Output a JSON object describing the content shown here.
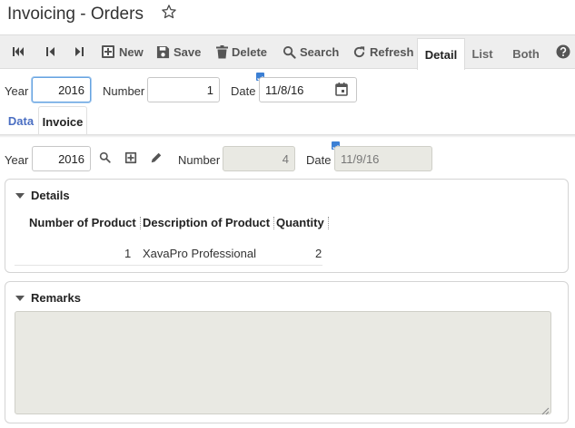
{
  "app": {
    "title": "Invoicing - Orders"
  },
  "toolbar": {
    "first_label": "",
    "prev_label": "",
    "next_label": "",
    "new_label": "New",
    "save_label": "Save",
    "delete_label": "Delete",
    "search_label": "Search",
    "refresh_label": "Refresh",
    "views": [
      {
        "label": "Detail",
        "active": true
      },
      {
        "label": "List",
        "active": false
      },
      {
        "label": "Both",
        "active": false
      }
    ]
  },
  "order": {
    "year_label": "Year",
    "year_value": "2016",
    "number_label": "Number",
    "number_value": "1",
    "date_label": "Date",
    "date_value": "11/8/16"
  },
  "subtabs": [
    {
      "label": "Data",
      "active": false
    },
    {
      "label": "Invoice",
      "active": true
    }
  ],
  "invoice": {
    "year_label": "Year",
    "year_value": "2016",
    "number_label": "Number",
    "number_value": "4",
    "date_label": "Date",
    "date_value": "11/9/16"
  },
  "details": {
    "title": "Details",
    "columns": [
      "Number of Product",
      "Description of Product",
      "Quantity"
    ],
    "rows": [
      {
        "number": "1",
        "description": "XavaPro Professional",
        "quantity": "2"
      }
    ]
  },
  "remarks": {
    "title": "Remarks",
    "value": ""
  },
  "colors": {
    "accent": "#4a6ec2",
    "toolbar_bg": "#eeeeee",
    "readonly_bg": "#e9e9e3",
    "focus_border": "#66a3e0"
  }
}
